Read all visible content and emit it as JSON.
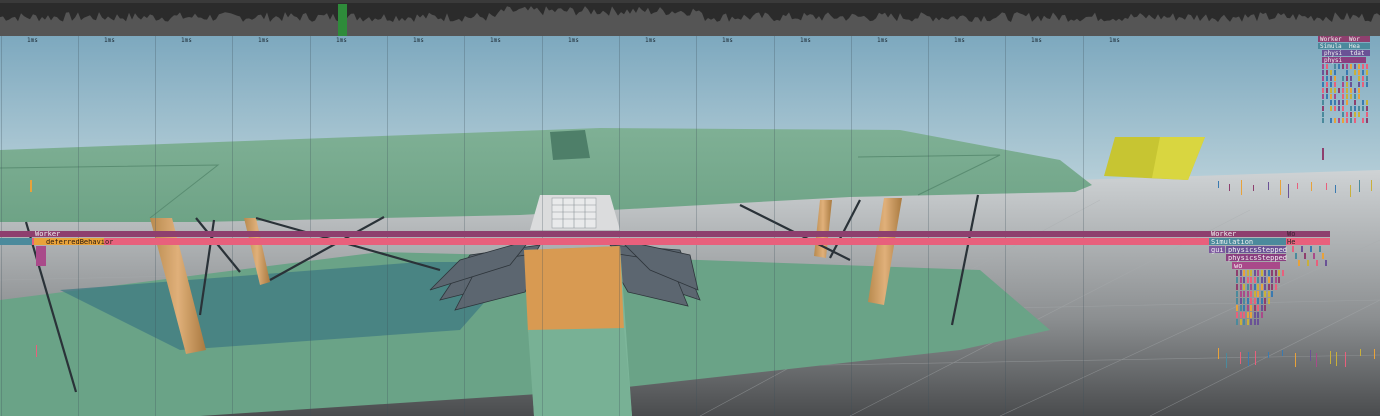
{
  "profiler": {
    "tick_label": "1ms",
    "tick_count": 15,
    "frame_labels": {
      "worker": "Worker",
      "deferred_task": "deferredBehavior",
      "simulation": "Simulation",
      "physics_stepped_1": "physicsStepped",
      "physics_stepped_2": "physicsStepped",
      "wo": "wo",
      "wo2": "Wo",
      "he": "He",
      "gui": "gui",
      "right_worker": "Worker",
      "right_wor": "Wor",
      "right_simula": "Simula",
      "right_hea": "Hea",
      "right_physi": "physi",
      "right_tdat": "tdat",
      "right_physi2": "physi"
    },
    "colors": {
      "worker_bar": "#8e3f6e",
      "main_bar": "#e8607c",
      "deferred_bar": "#e8a23a",
      "simulation_bar": "#4b8a9c",
      "topbar": "#2b2b2b",
      "histogram": "#555555",
      "selected_frame": "#2e8b3a"
    }
  }
}
